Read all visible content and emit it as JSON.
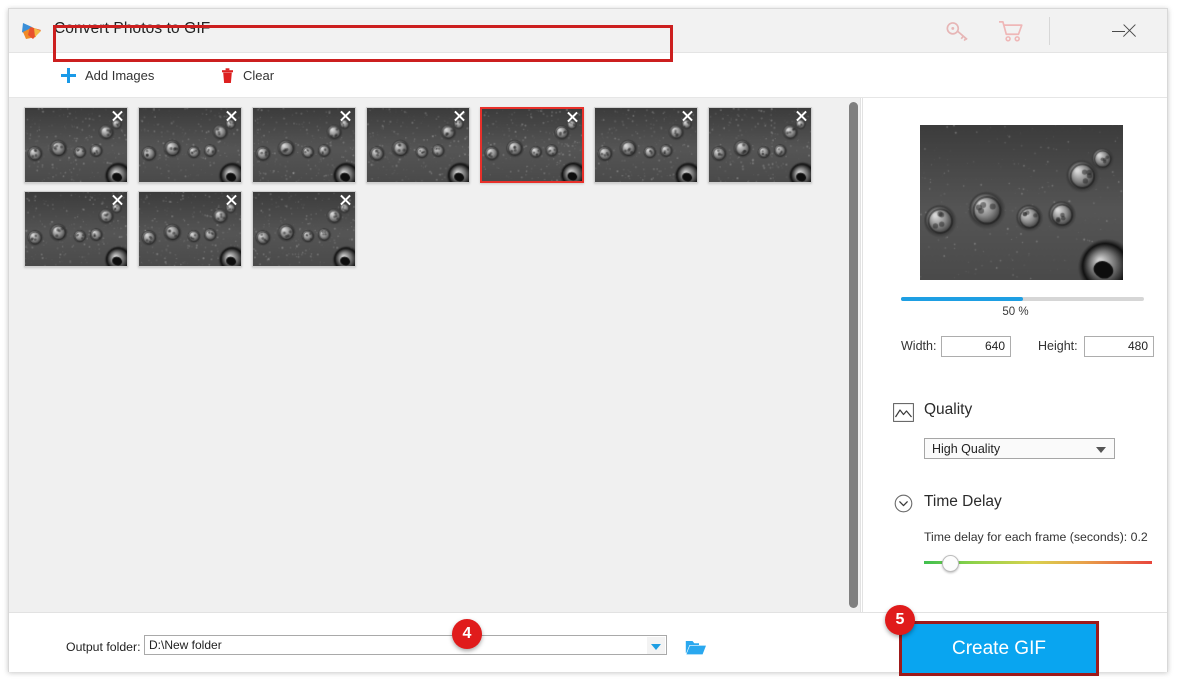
{
  "window": {
    "title": "Convert Photos to GIF",
    "logo_icon": "app-logo-play-icon",
    "controls": {
      "key_icon": "key-icon",
      "cart_icon": "shopping-cart-icon",
      "minimize_icon": "minimize-icon",
      "close_icon": "close-icon"
    }
  },
  "toolbar": {
    "add_images_label": "Add Images",
    "add_images_icon": "plus-icon",
    "clear_label": "Clear",
    "clear_icon": "trash-icon"
  },
  "thumbnails": {
    "count": 10,
    "selected_index": 4,
    "remove_icon": "close-icon"
  },
  "preview": {
    "size_percent_label": "50 %",
    "size_percent_value": 50,
    "width_label": "Width:",
    "width_value": "640",
    "height_label": "Height:",
    "height_value": "480"
  },
  "quality": {
    "heading": "Quality",
    "icon": "image-mountain-icon",
    "selected_option": "High Quality",
    "dropdown_icon": "chevron-down-icon"
  },
  "time_delay": {
    "heading": "Time Delay",
    "icon": "clock-chevron-icon",
    "description": "Time delay for each frame (seconds):  0.2",
    "value": "0.2",
    "slider_position_percent": 8
  },
  "output": {
    "label": "Output folder:",
    "value": "D:\\New folder",
    "dropdown_icon": "chevron-down-icon",
    "browse_icon": "folder-icon"
  },
  "create": {
    "button_label": "Create GIF"
  },
  "badges": {
    "output_step": "4",
    "create_step": "5"
  },
  "colors": {
    "accent_blue": "#09a5f0",
    "progress_blue": "#1e9fe3",
    "highlight_red": "#cc1f1f",
    "badge_red": "#e01b1b",
    "selection_red": "#e8302a"
  }
}
